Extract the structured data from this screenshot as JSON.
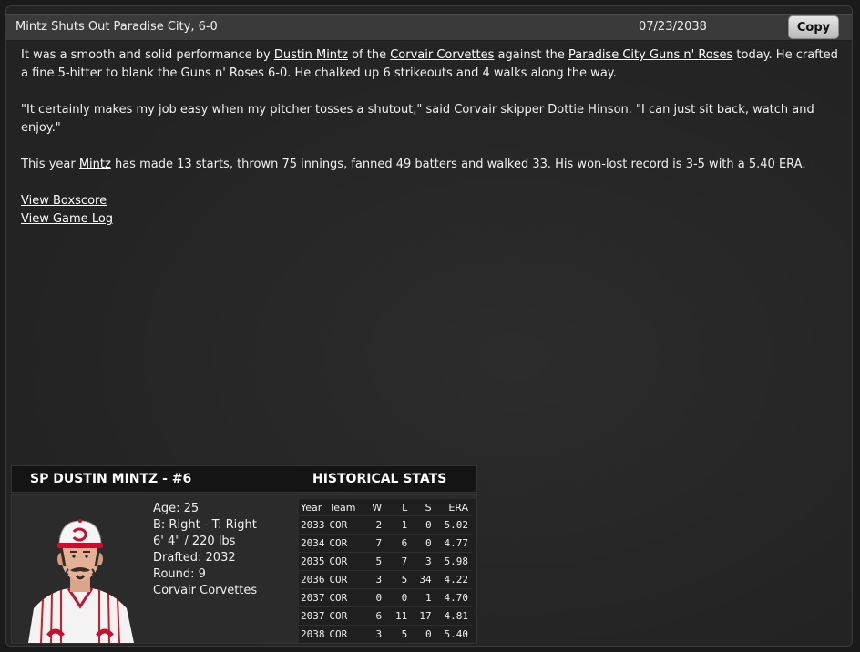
{
  "header": {
    "title": "Mintz Shuts Out Paradise City, 6-0",
    "date": "07/23/2038",
    "copy_label": "Copy"
  },
  "article": {
    "p1": {
      "t1": "It was a smooth and solid performance by ",
      "link_player": "Dustin Mintz",
      "t2": " of the ",
      "link_team": "Corvair Corvettes",
      "t3": " against the ",
      "link_opponent": "Paradise City Guns n' Roses",
      "t4": " today. He crafted a fine 5-hitter to blank the Guns n' Roses 6-0. He chalked up 6 strikeouts and 4 walks along the way."
    },
    "p2": "\"It certainly makes my job easy when my pitcher tosses a shutout,\" said Corvair skipper Dottie Hinson. \"I can just sit back, watch and enjoy.\"",
    "p3": {
      "t1": "This year ",
      "link_player": "Mintz",
      "t2": " has made 13 starts, thrown 75 innings, fanned 49 batters and walked 33. His won-lost record is 3-5 with a 5.40 ERA."
    },
    "links": {
      "boxscore": "View Boxscore",
      "gamelog": "View Game Log"
    }
  },
  "player_card": {
    "name": "SP DUSTIN MINTZ - #6",
    "historical_title": "HISTORICAL STATS",
    "bio": {
      "age": "Age: 25",
      "bats_throws": "B: Right - T: Right",
      "height_weight": "6' 4\" / 220 lbs",
      "drafted": "Drafted: 2032",
      "round": "Round: 9",
      "team": "Corvair Corvettes"
    },
    "stats": {
      "headers": [
        "Year",
        "Team",
        "W",
        "L",
        "S",
        "ERA"
      ],
      "rows": [
        [
          "2033",
          "COR",
          "2",
          "1",
          "0",
          "5.02"
        ],
        [
          "2034",
          "COR",
          "7",
          "6",
          "0",
          "4.77"
        ],
        [
          "2035",
          "COR",
          "5",
          "7",
          "3",
          "5.98"
        ],
        [
          "2036",
          "COR",
          "3",
          "5",
          "34",
          "4.22"
        ],
        [
          "2037",
          "COR",
          "0",
          "0",
          "1",
          "4.70"
        ],
        [
          "2037",
          "COR",
          "6",
          "11",
          "17",
          "4.81"
        ],
        [
          "2038",
          "COR",
          "3",
          "5",
          "0",
          "5.40"
        ]
      ]
    }
  },
  "colors": {
    "background": "#262626",
    "titlebar": "#3a3a3a",
    "jersey_red": "#c8102e"
  }
}
